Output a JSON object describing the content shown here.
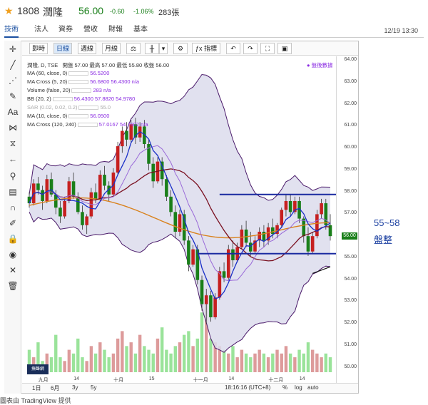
{
  "header": {
    "code": "1808",
    "name": "潤隆",
    "price": "56.00",
    "change": "-0.60",
    "change_pct": "-1.06%",
    "volume": "283張"
  },
  "tabs": [
    "技術",
    "法人",
    "資券",
    "營收",
    "財報",
    "基本"
  ],
  "timestamp": "12/19 13:30",
  "toolbar": {
    "buttons": [
      "即時",
      "日線",
      "週線",
      "月線",
      "⚖",
      "",
      "",
      "⚙",
      "指標",
      "↶",
      "↷",
      "⛶",
      "📷"
    ],
    "periods": [
      "即時",
      "日線",
      "週線",
      "月線"
    ],
    "indicators_label": "指標",
    "after_hours_label": "盤後數據"
  },
  "legend": {
    "title": "潤隆, D, TSE",
    "ohlc": "開盤 57.00 最高 57.00 最低 55.80 收盤 56.00",
    "lines": [
      {
        "label": "MA (60, close, 0)",
        "value": "56.5200"
      },
      {
        "label": "MA Cross (5, 20)",
        "value": "56.6800  56.4300  n/a"
      },
      {
        "label": "Volume (false, 20)",
        "value": "283  n/a"
      },
      {
        "label": "BB (20, 2)",
        "value": "56.4300  57.8820  54.9780"
      },
      {
        "label": "SAR (0.02, 0.02, 0.2)",
        "value": "55.0"
      },
      {
        "label": "MA (10, close, 0)",
        "value": "56.0500"
      },
      {
        "label": "MA Cross (120, 240)",
        "value": "57.0167  54.7602  n/a"
      }
    ]
  },
  "yaxis_ticks": [
    "64.00",
    "63.00",
    "62.00",
    "61.00",
    "60.00",
    "59.00",
    "58.00",
    "57.00",
    "56.00",
    "55.00",
    "54.00",
    "53.00",
    "52.00",
    "51.00",
    "50.00"
  ],
  "current_price_tag": "56.00",
  "xaxis_ticks": [
    "九月",
    "14",
    "十月",
    "15",
    "十一月",
    "14",
    "十二月",
    "14"
  ],
  "bottom_bar": {
    "ranges": [
      "1日",
      "6月",
      "3y",
      "5y"
    ],
    "clock": "18:16:16 (UTC+8)",
    "pct": "%",
    "log": "log",
    "auto": "auto"
  },
  "sticker_text": "撫聲網",
  "annotations": {
    "range": "55~58",
    "label": "盤整"
  },
  "credit": "圖表由 TradingView 提供",
  "colors": {
    "up": "#c62020",
    "down": "#1a7f1a",
    "band": "#b8b4d8",
    "bandfill": "#dcdcec",
    "ma60": "#d9821e",
    "ma5": "#1a30c8",
    "ma20": "#7a1020",
    "hline": "#1a2aa0"
  },
  "chart_data": {
    "type": "candlestick",
    "ylim": [
      49.6,
      64.2
    ],
    "candles": [
      [
        57.8,
        58.0,
        57.3,
        57.5
      ],
      [
        57.5,
        58.6,
        57.4,
        58.4
      ],
      [
        58.4,
        58.7,
        57.9,
        58.1
      ],
      [
        58.1,
        58.3,
        57.2,
        57.6
      ],
      [
        57.6,
        58.8,
        57.5,
        58.6
      ],
      [
        58.6,
        58.9,
        57.8,
        57.9
      ],
      [
        57.9,
        58.1,
        57.0,
        57.3
      ],
      [
        57.3,
        57.6,
        56.6,
        56.9
      ],
      [
        56.9,
        57.8,
        56.8,
        57.6
      ],
      [
        57.6,
        58.7,
        57.5,
        58.5
      ],
      [
        58.5,
        58.9,
        57.7,
        57.8
      ],
      [
        57.8,
        58.0,
        57.0,
        57.1
      ],
      [
        57.1,
        57.4,
        56.3,
        56.5
      ],
      [
        56.5,
        57.0,
        56.1,
        56.9
      ],
      [
        56.9,
        58.2,
        56.8,
        58.0
      ],
      [
        58.0,
        58.4,
        57.5,
        57.7
      ],
      [
        57.7,
        59.0,
        57.6,
        58.8
      ],
      [
        58.8,
        59.2,
        58.1,
        58.3
      ],
      [
        58.3,
        58.5,
        57.6,
        57.9
      ],
      [
        57.9,
        59.1,
        57.8,
        58.9
      ],
      [
        58.9,
        60.3,
        58.8,
        60.1
      ],
      [
        60.1,
        61.0,
        59.8,
        60.8
      ],
      [
        60.8,
        61.2,
        60.1,
        60.4
      ],
      [
        60.4,
        61.3,
        60.3,
        61.1
      ],
      [
        61.1,
        61.4,
        60.2,
        60.5
      ],
      [
        60.5,
        61.2,
        60.3,
        61.0
      ],
      [
        61.0,
        61.3,
        60.0,
        60.2
      ],
      [
        60.2,
        60.4,
        59.0,
        59.3
      ],
      [
        59.3,
        59.6,
        58.2,
        58.5
      ],
      [
        58.5,
        59.6,
        58.4,
        59.4
      ],
      [
        59.4,
        59.6,
        58.3,
        58.6
      ],
      [
        58.6,
        58.8,
        57.6,
        57.8
      ],
      [
        57.8,
        58.1,
        56.9,
        57.1
      ],
      [
        57.1,
        57.4,
        55.9,
        56.2
      ],
      [
        56.2,
        57.2,
        56.0,
        57.0
      ],
      [
        57.0,
        57.2,
        55.6,
        55.8
      ],
      [
        55.8,
        56.0,
        54.4,
        54.7
      ],
      [
        54.7,
        55.6,
        54.6,
        55.4
      ],
      [
        55.4,
        55.6,
        53.8,
        54.0
      ],
      [
        54.0,
        54.2,
        52.6,
        52.9
      ],
      [
        52.9,
        53.6,
        52.0,
        53.3
      ],
      [
        53.3,
        53.5,
        52.1,
        52.3
      ],
      [
        52.3,
        53.4,
        52.2,
        53.2
      ],
      [
        53.2,
        54.6,
        53.1,
        54.4
      ],
      [
        54.4,
        54.8,
        53.9,
        54.1
      ],
      [
        54.1,
        55.6,
        54.0,
        55.4
      ],
      [
        55.4,
        55.8,
        54.6,
        54.9
      ],
      [
        54.9,
        55.7,
        54.8,
        55.5
      ],
      [
        55.5,
        56.5,
        55.4,
        56.3
      ],
      [
        56.3,
        56.7,
        55.5,
        55.7
      ],
      [
        55.7,
        56.2,
        55.1,
        55.3
      ],
      [
        55.3,
        56.0,
        55.2,
        55.8
      ],
      [
        55.8,
        56.4,
        55.5,
        56.2
      ],
      [
        56.2,
        56.5,
        55.5,
        55.8
      ],
      [
        55.8,
        56.6,
        55.6,
        56.4
      ],
      [
        56.4,
        56.8,
        55.9,
        56.1
      ],
      [
        56.1,
        56.6,
        55.9,
        56.5
      ],
      [
        56.5,
        57.3,
        56.4,
        57.2
      ],
      [
        57.2,
        57.9,
        56.9,
        57.6
      ],
      [
        57.6,
        57.9,
        56.9,
        57.1
      ],
      [
        57.1,
        57.8,
        57.0,
        57.6
      ],
      [
        57.6,
        57.8,
        56.6,
        56.8
      ],
      [
        56.8,
        56.9,
        55.7,
        56.0
      ],
      [
        56.0,
        56.4,
        55.1,
        55.3
      ],
      [
        55.3,
        56.2,
        55.2,
        56.0
      ],
      [
        56.0,
        57.2,
        55.9,
        57.0
      ],
      [
        57.0,
        57.7,
        56.8,
        57.5
      ],
      [
        57.5,
        57.7,
        56.3,
        56.5
      ],
      [
        56.5,
        57.0,
        55.8,
        56.0
      ]
    ],
    "volumes": [
      6,
      4,
      8,
      3,
      5,
      4,
      10,
      4,
      3,
      6,
      5,
      9,
      4,
      3,
      7,
      5,
      8,
      6,
      4,
      5,
      9,
      11,
      7,
      8,
      5,
      10,
      7,
      6,
      5,
      9,
      12,
      6,
      5,
      7,
      8,
      10,
      11,
      7,
      9,
      16,
      21,
      9,
      8,
      7,
      6,
      5,
      7,
      4,
      6,
      5,
      4,
      5,
      6,
      5,
      4,
      5,
      6,
      5,
      7,
      5,
      4,
      6,
      5,
      8,
      6,
      5,
      4,
      5,
      4
    ]
  }
}
